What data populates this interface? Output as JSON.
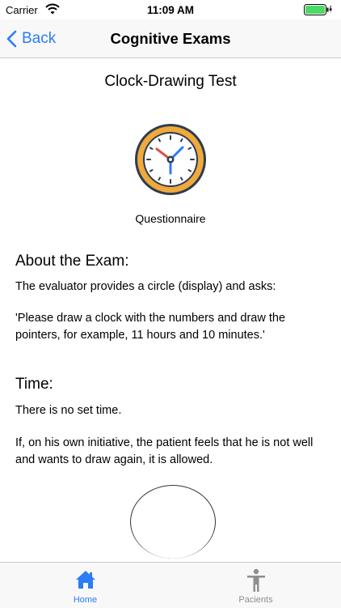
{
  "status": {
    "carrier": "Carrier",
    "time": "11:09 AM"
  },
  "nav": {
    "back_label": "Back",
    "title": "Cognitive Exams"
  },
  "exam": {
    "title": "Clock-Drawing Test",
    "icon": "clock-icon",
    "caption": "Questionnaire"
  },
  "about": {
    "heading": "About the Exam:",
    "p1": "The evaluator provides a circle (display) and asks:",
    "p2": "'Please draw a clock with the numbers and draw the pointers, for example, 11 hours and 10 minutes.'"
  },
  "time": {
    "heading": "Time:",
    "p1": "There is no set time.",
    "p2": "If, on his own initiative, the patient feels that he is not well and wants to draw again, it is allowed."
  },
  "tabs": [
    {
      "label": "Home",
      "icon": "home-icon",
      "active": true
    },
    {
      "label": "Pacients",
      "icon": "person-icon",
      "active": false
    }
  ],
  "colors": {
    "accent": "#2b7cf6",
    "clock_rim": "#f0a93b",
    "clock_outline": "#2e3c50",
    "hand_red": "#d9534f",
    "hand_blue": "#2b7cf6",
    "battery": "#4cd964"
  }
}
